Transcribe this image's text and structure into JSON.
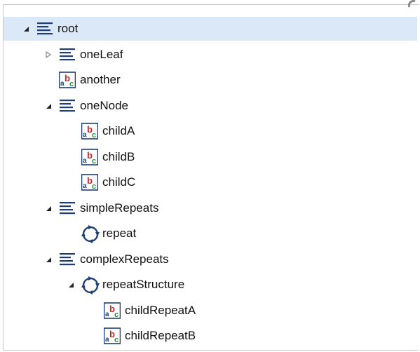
{
  "tree": {
    "nodes": [
      {
        "id": "root",
        "label": "root",
        "level": 0,
        "icon": "structure-icon",
        "expander": "expanded",
        "selected": true
      },
      {
        "id": "oneLeaf",
        "label": "oneLeaf",
        "level": 1,
        "icon": "structure-icon",
        "expander": "collapsed"
      },
      {
        "id": "another",
        "label": "another",
        "level": 1,
        "icon": "string-field-icon",
        "expander": "none"
      },
      {
        "id": "oneNode",
        "label": "oneNode",
        "level": 1,
        "icon": "structure-icon",
        "expander": "expanded"
      },
      {
        "id": "childA",
        "label": "childA",
        "level": 2,
        "icon": "string-field-icon",
        "expander": "none"
      },
      {
        "id": "childB",
        "label": "childB",
        "level": 2,
        "icon": "string-field-icon",
        "expander": "none"
      },
      {
        "id": "childC",
        "label": "childC",
        "level": 2,
        "icon": "string-field-icon",
        "expander": "none"
      },
      {
        "id": "simpleRepeats",
        "label": "simpleRepeats",
        "level": 1,
        "icon": "structure-icon",
        "expander": "expanded"
      },
      {
        "id": "repeat",
        "label": "repeat",
        "level": 2,
        "icon": "repeat-icon",
        "expander": "none"
      },
      {
        "id": "complexRepeats",
        "label": "complexRepeats",
        "level": 1,
        "icon": "structure-icon",
        "expander": "expanded"
      },
      {
        "id": "repeatStructure",
        "label": "repeatStructure",
        "level": 2,
        "icon": "repeat-icon",
        "expander": "expanded"
      },
      {
        "id": "childRepeatA",
        "label": "childRepeatA",
        "level": 3,
        "icon": "string-field-icon",
        "expander": "none"
      },
      {
        "id": "childRepeatB",
        "label": "childRepeatB",
        "level": 3,
        "icon": "string-field-icon",
        "expander": "none"
      }
    ]
  },
  "colors": {
    "selection": "#dbe8f7",
    "icon_blue": "#1f3f73",
    "abc_red": "#c0282d",
    "abc_green": "#2d8c3c"
  }
}
